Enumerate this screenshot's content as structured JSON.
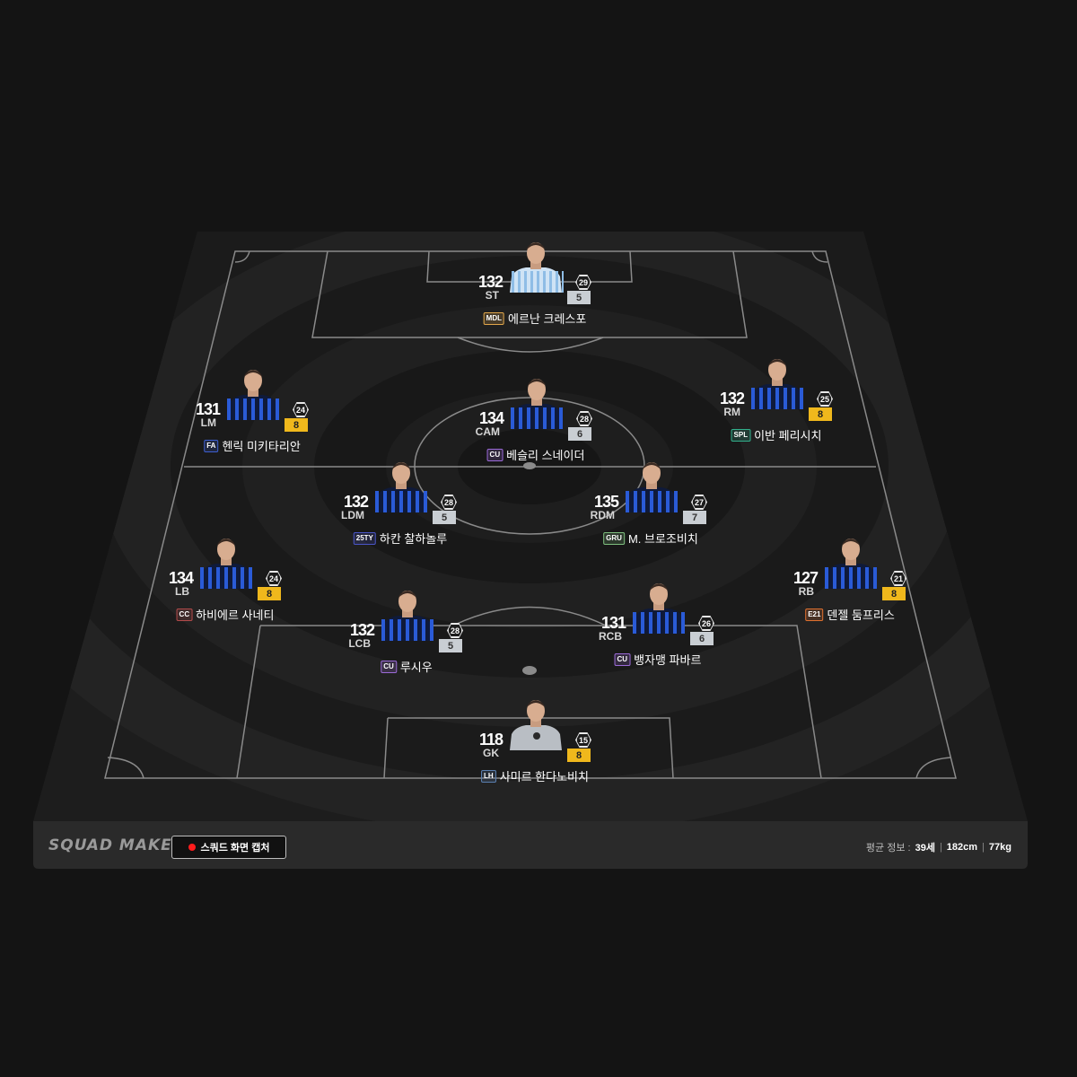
{
  "app": {
    "logo": "SQUAD MAKER",
    "capture_button": "스쿼드 화면 캡처",
    "avg_label": "평균 정보 :",
    "avg_age": "39세",
    "avg_height": "182cm",
    "avg_weight": "77kg"
  },
  "colors": {
    "background": "#141414",
    "pitch": "#1e1e1e",
    "line": "#8a8a8a",
    "grade_gold": "#f0b81c",
    "grade_silver": "#c9ced3",
    "rec_dot": "#ff1c1c"
  },
  "players": [
    {
      "ovr": "132",
      "pos": "ST",
      "age": "29",
      "grade": "5",
      "grade_color": "silver",
      "season": "MDL",
      "season_color": "#e0a64a",
      "name": "에르난 크레스포",
      "kit": "lazio"
    },
    {
      "ovr": "131",
      "pos": "LM",
      "age": "24",
      "grade": "8",
      "grade_color": "gold",
      "season": "FA",
      "season_color": "#3d5fd1",
      "name": "헨릭 미키타리안",
      "kit": "inter"
    },
    {
      "ovr": "134",
      "pos": "CAM",
      "age": "28",
      "grade": "6",
      "grade_color": "silver",
      "season": "CU",
      "season_color": "#9b6ad8",
      "name": "베슬리 스네이더",
      "kit": "inter"
    },
    {
      "ovr": "132",
      "pos": "RM",
      "age": "25",
      "grade": "8",
      "grade_color": "gold",
      "season": "SPL",
      "season_color": "#32b08c",
      "name": "이반 페리시치",
      "kit": "inter"
    },
    {
      "ovr": "132",
      "pos": "LDM",
      "age": "28",
      "grade": "5",
      "grade_color": "silver",
      "season": "25TY",
      "season_color": "#4a55c8",
      "name": "하칸 찰하놀루",
      "kit": "inter"
    },
    {
      "ovr": "135",
      "pos": "RDM",
      "age": "27",
      "grade": "7",
      "grade_color": "silver",
      "season": "GRU",
      "season_color": "#7fbf7f",
      "name": "M. 브로조비치",
      "kit": "inter"
    },
    {
      "ovr": "134",
      "pos": "LB",
      "age": "24",
      "grade": "8",
      "grade_color": "gold",
      "season": "CC",
      "season_color": "#b24a4a",
      "name": "하비에르 사네티",
      "kit": "inter"
    },
    {
      "ovr": "127",
      "pos": "RB",
      "age": "21",
      "grade": "8",
      "grade_color": "gold",
      "season": "E21",
      "season_color": "#e0702e",
      "name": "덴젤 둠프리스",
      "kit": "inter"
    },
    {
      "ovr": "132",
      "pos": "LCB",
      "age": "28",
      "grade": "5",
      "grade_color": "silver",
      "season": "CU",
      "season_color": "#9b6ad8",
      "name": "루시우",
      "kit": "inter"
    },
    {
      "ovr": "131",
      "pos": "RCB",
      "age": "26",
      "grade": "6",
      "grade_color": "silver",
      "season": "CU",
      "season_color": "#9b6ad8",
      "name": "뱅자맹 파바르",
      "kit": "inter"
    },
    {
      "ovr": "118",
      "pos": "GK",
      "age": "15",
      "grade": "8",
      "grade_color": "gold",
      "season": "LH",
      "season_color": "#5a7fb0",
      "name": "사미르 한다노비치",
      "kit": "gk"
    }
  ]
}
